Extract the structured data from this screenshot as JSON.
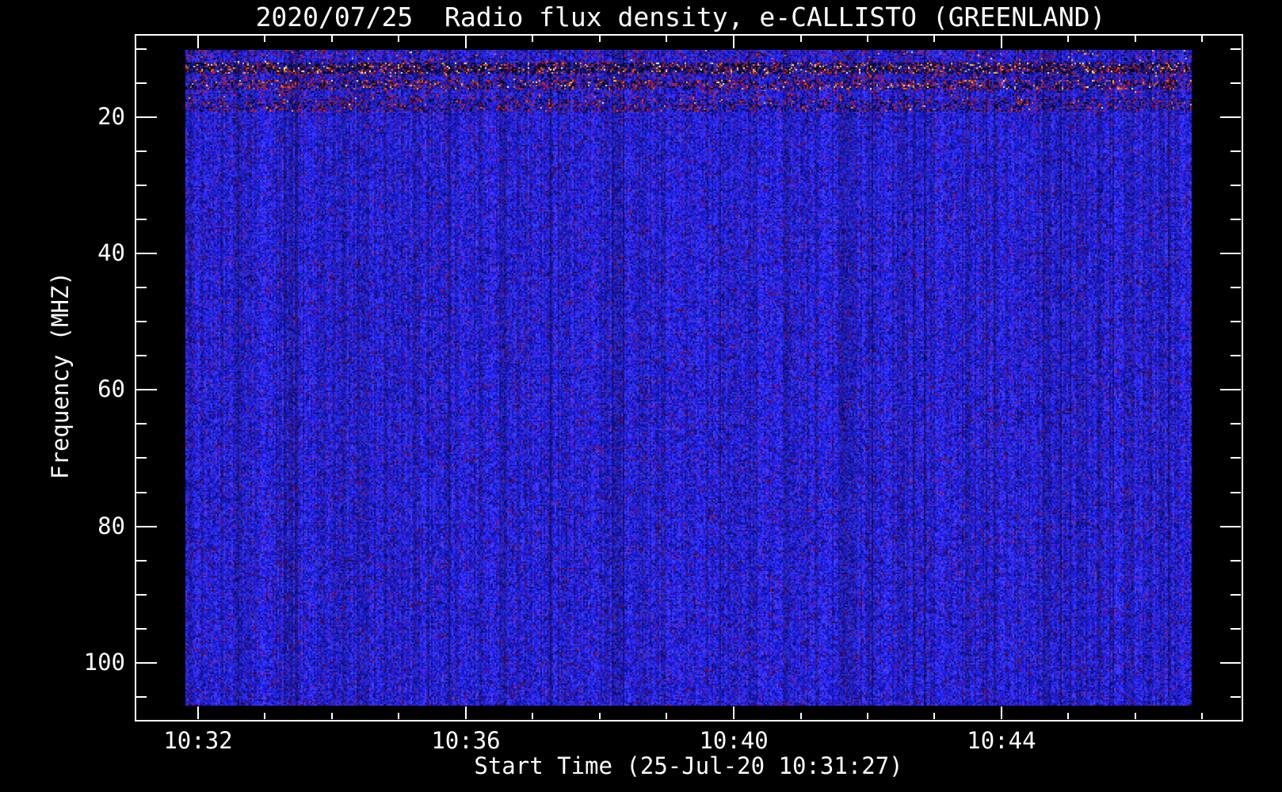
{
  "window": {
    "background": "#000000",
    "axis_color": "#ffffff",
    "text_color": "#ffffff"
  },
  "chart_data": {
    "type": "heatmap",
    "title": "2020/07/25  Radio flux density, e-CALLISTO (GREENLAND)",
    "xlabel": "Start Time (25-Jul-20 10:31:27)",
    "ylabel": "Frequency (MHZ)",
    "grid": false,
    "legend": false,
    "y_axis": {
      "unit": "MHZ",
      "range": [
        7.9,
        108.4
      ],
      "major_ticks": [
        20,
        40,
        60,
        80,
        100
      ],
      "minor_step": 5,
      "direction": "increasing-downward"
    },
    "x_axis": {
      "start_time": "10:31:27",
      "major_tick_labels": [
        "10:32",
        "10:36",
        "10:40",
        "10:44"
      ],
      "major_tick_fractions": [
        0.0566,
        0.2987,
        0.5409,
        0.7829
      ],
      "minor_step_fraction": 0.0605,
      "minor_per_major": 3
    },
    "colormap": {
      "background": "#000000",
      "base_blue_bright": "#2a2aee",
      "base_blue_mid": "#1c1cc8",
      "base_blue_deep": "#14148c",
      "base_navy_dark": "#0e0e64",
      "speck_purple": "#6414a0",
      "speck_maroon": "#8c0a3c",
      "speck_dark_red": "#500814",
      "rfi_black": "#05050f",
      "rfi_red": "#d41e05",
      "rfi_orange": "#ff6e00",
      "rfi_yellow": "#ffc83c",
      "rfi_white": "#ffffeb"
    },
    "rfi_bands": [
      {
        "name": "band-10mhz-faint",
        "freq_range": [
          10.0,
          11.9
        ],
        "dim": 1.0,
        "p_black": 0.03,
        "p_red": 0.045,
        "p_orange": 0.006,
        "p_yellow": 0.003,
        "p_white": 0.001
      },
      {
        "name": "band-12mhz-strong",
        "freq_range": [
          11.9,
          13.6
        ],
        "dim": 0.8,
        "p_black": 0.26,
        "p_red": 0.1,
        "p_orange": 0.05,
        "p_yellow": 0.03,
        "p_white": 0.015
      },
      {
        "name": "band-13mhz-weak",
        "freq_range": [
          13.6,
          14.55
        ],
        "dim": 0.95,
        "p_black": 0.05,
        "p_red": 0.07,
        "p_orange": 0.004,
        "p_yellow": 0.002,
        "p_white": 0.0
      },
      {
        "name": "band-15mhz-medium",
        "freq_range": [
          14.55,
          15.95
        ],
        "dim": 0.9,
        "p_black": 0.14,
        "p_red": 0.13,
        "p_orange": 0.045,
        "p_yellow": 0.018,
        "p_white": 0.004
      },
      {
        "name": "band-16mhz-faint",
        "freq_range": [
          15.95,
          17.25
        ],
        "dim": 1.0,
        "p_black": 0.04,
        "p_red": 0.05,
        "p_orange": 0.003,
        "p_yellow": 0.001,
        "p_white": 0.0
      },
      {
        "name": "band-18mhz-weak",
        "freq_range": [
          17.25,
          19.1
        ],
        "dim": 0.92,
        "p_black": 0.1,
        "p_red": 0.085,
        "p_orange": 0.012,
        "p_yellow": 0.003,
        "p_white": 0.001
      }
    ]
  }
}
